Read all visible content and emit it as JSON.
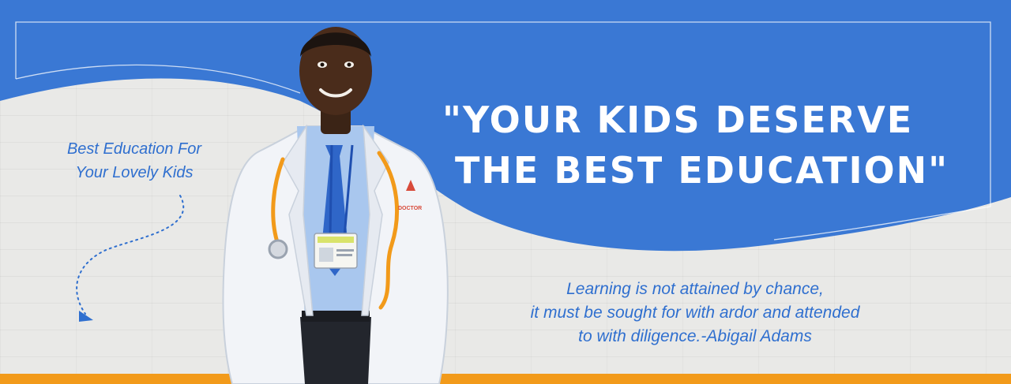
{
  "banner": {
    "headline": {
      "line1": "\"YOUR KIDS DESERVE",
      "line2": "THE BEST EDUCATION\""
    },
    "tagline": {
      "line1": "Best Education For",
      "line2": "Your Lovely Kids"
    },
    "quote": {
      "line1": "Learning is not attained by chance,",
      "line2": "it must be sought for with ardor and attended",
      "line3": "to with diligence.-Abigail Adams"
    },
    "badge_text": "DOCTOR"
  },
  "colors": {
    "brand_blue": "#3a78d4",
    "text_blue": "#2f6fcf",
    "accent_orange": "#f29a1a",
    "brick_white": "#e9e9e7"
  }
}
